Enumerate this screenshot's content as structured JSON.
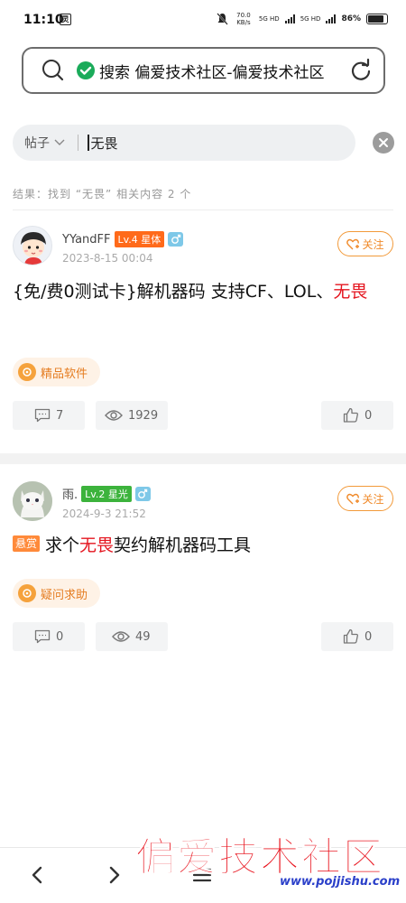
{
  "status_bar": {
    "time": "11:10",
    "network_speed": "70.0 KB/s",
    "sim1": "5G HD",
    "sim2": "5G HD",
    "battery": "86%"
  },
  "browser": {
    "url_text": "搜索 偏爱技术社区-偏爱技术社区"
  },
  "search": {
    "scope_label": "帖子",
    "query": "无畏",
    "result_summary": "结果：找到 “无畏” 相关内容 2 个"
  },
  "posts": [
    {
      "author": "YYandFF",
      "level": "Lv.4 星体",
      "level_color": "#ff6a1a",
      "date": "2023-8-15 00:04",
      "follow_label": "关注",
      "title_before": "{免/费0测试卡}解机器码 支持CF、LOL、",
      "title_highlight": "无畏",
      "title_after": "",
      "bounty_label": "",
      "tag": "精品软件",
      "comments": "7",
      "views": "1929",
      "likes": "0"
    },
    {
      "author": "雨.",
      "level": "Lv.2 星光",
      "level_color": "#3cb33c",
      "date": "2024-9-3 21:52",
      "follow_label": "关注",
      "title_before": "求个",
      "title_highlight": "无畏",
      "title_after": "契约解机器码工具",
      "bounty_label": "悬赏",
      "tag": "疑问求助",
      "comments": "0",
      "views": "49",
      "likes": "0"
    }
  ],
  "watermark": {
    "title": "偏爱技术社区",
    "url": "www.pojjishu.com"
  },
  "colors": {
    "accent_orange": "#f08a2a",
    "highlight_red": "#e4141e",
    "verified_green": "#1aab5a"
  }
}
